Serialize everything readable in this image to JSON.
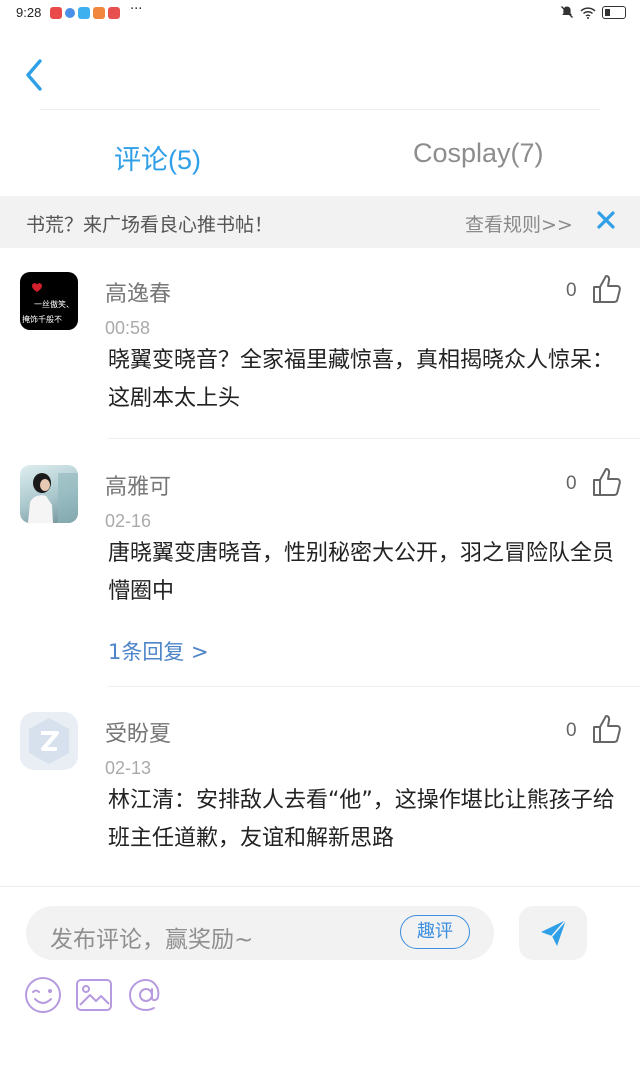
{
  "status_bar": {
    "time": "9:28",
    "more": "···"
  },
  "tabs": [
    {
      "label": "评论(5)",
      "active": true
    },
    {
      "label": "Cosplay(7)",
      "active": false
    }
  ],
  "notice": {
    "text": "书荒？来广场看良心推书帖！",
    "rules_link": "查看规则>>"
  },
  "comments": [
    {
      "name": "高逸春",
      "time": "00:58",
      "text": "晓翼变晓音？全家福里藏惊喜，真相揭晓众人惊呆：这剧本太上头",
      "likes": "0",
      "avatar_text_1": "一丝傲笑、",
      "avatar_text_2": "掩饰千般不"
    },
    {
      "name": "高雅可",
      "time": "02-16",
      "text": "唐晓翼变唐晓音，性别秘密大公开，羽之冒险队全员懵圈中",
      "likes": "0",
      "reply": "1条回复 >"
    },
    {
      "name": "受盼夏",
      "time": "02-13",
      "text": "林江清：安排敌人去看“他”，这操作堪比让熊孩子给班主任道歉，友谊和解新思路",
      "likes": "0"
    }
  ],
  "composer": {
    "placeholder": "发布评论，赢奖励~",
    "quip_button": "趣评"
  },
  "colors": {
    "accent": "#2f9fe8",
    "tool_purple": "#b69be0",
    "reply_blue": "#4e84c8"
  }
}
